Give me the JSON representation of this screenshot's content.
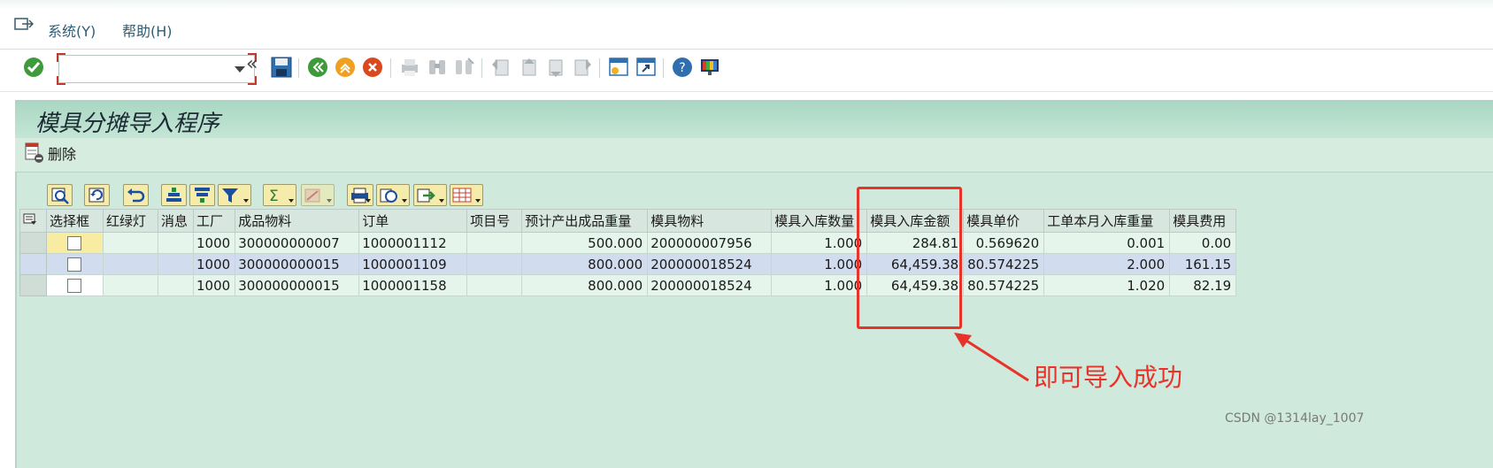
{
  "menu": {
    "items": [
      {
        "label": "系统(Y)"
      },
      {
        "label": "帮助(H)"
      }
    ]
  },
  "toolbar": {
    "command_value": "",
    "back_chevrons": "«"
  },
  "screen": {
    "title": "模具分摊导入程序"
  },
  "app_toolbar": {
    "delete_label": "删除"
  },
  "grid": {
    "columns": [
      "选择框",
      "红绿灯",
      "消息",
      "工厂",
      "成品物料",
      "订单",
      "项目号",
      "预计产出成品重量",
      "模具物料",
      "模具入库数量",
      "模具入库金额",
      "模具单价",
      "工单本月入库重量",
      "模具费用"
    ],
    "rows": [
      {
        "plant": "1000",
        "material": "300000000007",
        "order": "1000001112",
        "item": "",
        "exp_weight": "500.000",
        "mold_material": "200000007956",
        "mold_qty": "1.000",
        "mold_amount": "284.81",
        "unit_price": "0.569620",
        "month_weight": "0.001",
        "mold_cost": "0.00",
        "selected": false
      },
      {
        "plant": "1000",
        "material": "300000000015",
        "order": "1000001109",
        "item": "",
        "exp_weight": "800.000",
        "mold_material": "200000018524",
        "mold_qty": "1.000",
        "mold_amount": "64,459.38",
        "unit_price": "80.574225",
        "month_weight": "2.000",
        "mold_cost": "161.15",
        "selected": true
      },
      {
        "plant": "1000",
        "material": "300000000015",
        "order": "1000001158",
        "item": "",
        "exp_weight": "800.000",
        "mold_material": "200000018524",
        "mold_qty": "1.000",
        "mold_amount": "64,459.38",
        "unit_price": "80.574225",
        "month_weight": "1.020",
        "mold_cost": "82.19",
        "selected": false
      }
    ]
  },
  "annotation": {
    "text": "即可导入成功",
    "color": "#e8332a"
  },
  "watermark": "CSDN @1314lay_1007",
  "colors": {
    "main_bg": "#cfe9dc",
    "title_bg": "#a9d6c2",
    "selected_row": "#d1dcee"
  }
}
